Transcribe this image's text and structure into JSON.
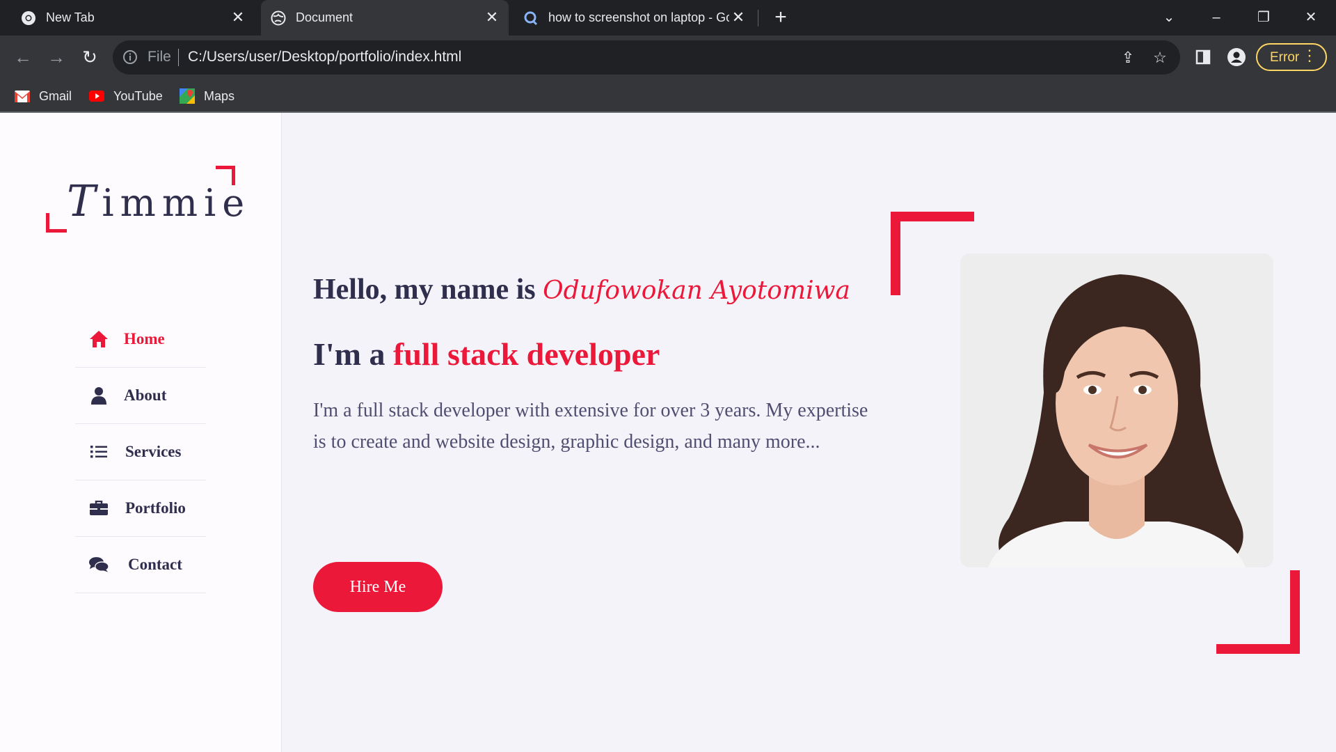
{
  "browser": {
    "tabs": [
      {
        "title": "New Tab",
        "icon": "chrome-icon",
        "active": false
      },
      {
        "title": "Document",
        "icon": "globe-icon",
        "active": true
      },
      {
        "title": "how to screenshot on laptop - Go",
        "icon": "google-search-icon",
        "active": false
      }
    ],
    "new_tab_symbol": "+",
    "address": {
      "scheme_label": "File",
      "url": "C:/Users/user/Desktop/portfolio/index.html"
    },
    "profile_button_label": "Error",
    "bookmarks": [
      {
        "label": "Gmail",
        "icon": "gmail-icon"
      },
      {
        "label": "YouTube",
        "icon": "youtube-icon"
      },
      {
        "label": "Maps",
        "icon": "maps-icon"
      }
    ]
  },
  "sidebar": {
    "logo": {
      "initial": "T",
      "rest": "immie"
    },
    "nav": [
      {
        "label": "Home",
        "icon": "home-icon",
        "active": true
      },
      {
        "label": "About",
        "icon": "user-icon",
        "active": false
      },
      {
        "label": "Services",
        "icon": "list-icon",
        "active": false
      },
      {
        "label": "Portfolio",
        "icon": "briefcase-icon",
        "active": false
      },
      {
        "label": "Contact",
        "icon": "comments-icon",
        "active": false
      }
    ]
  },
  "hero": {
    "greeting": "Hello, my name is ",
    "name": "Odufowokan Ayotomiwa",
    "role_prefix": "I'm a ",
    "role": "full stack developer",
    "description": "I'm a full stack developer with extensive for over 3 years. My expertise is to create and website design, graphic design, and many more...",
    "cta_label": "Hire Me"
  },
  "colors": {
    "accent": "#ec1839",
    "heading": "#302e4d",
    "body_text": "#504e70",
    "page_bg": "#f5f3fa",
    "chrome_dark": "#202124",
    "chrome_toolbar": "#35363a",
    "error_yellow": "#fdd663"
  }
}
